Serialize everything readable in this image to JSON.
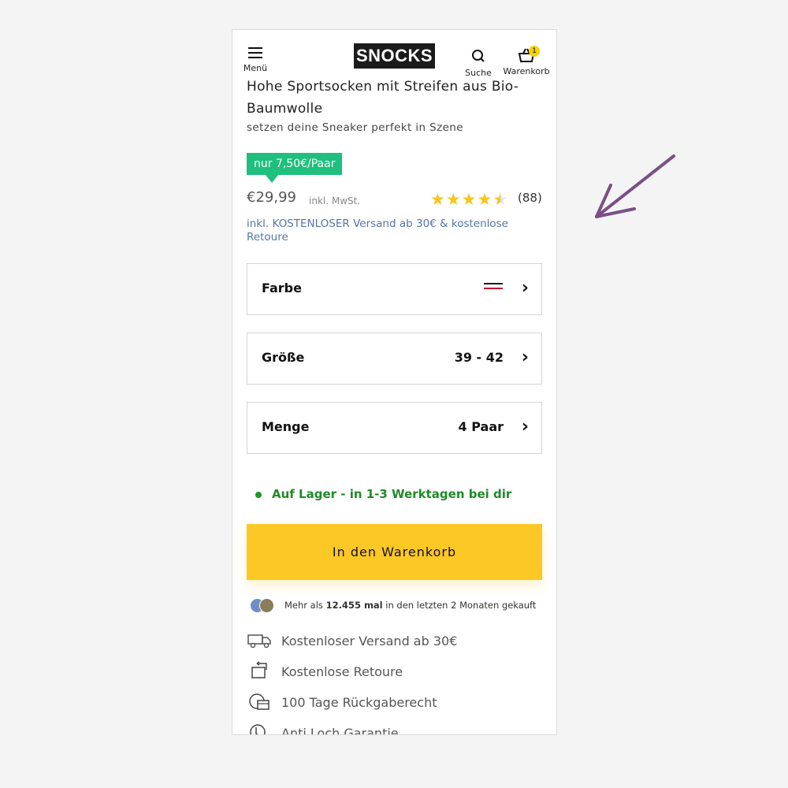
{
  "header": {
    "menu_label": "Menü",
    "logo_text": "SNOCKS",
    "search_label": "Suche",
    "cart_label": "Warenkorb",
    "cart_count": "1"
  },
  "product": {
    "title": "Hohe Sportsocken mit Streifen aus Bio-Baumwolle",
    "subtitle": "setzen deine Sneaker perfekt in Szene",
    "unit_price_badge": "nur 7,50€/Paar",
    "price": "€29,99",
    "tax_note": "inkl. MwSt.",
    "rating_stars": 4.5,
    "review_count": "(88)",
    "shipping_note": "inkl. KOSTENLOSER Versand ab 30€ & kostenlose Retoure"
  },
  "options": {
    "color": {
      "label": "Farbe",
      "swatch_colors": [
        "#1a1a1a",
        "#ffffff",
        "#c8102e"
      ]
    },
    "size": {
      "label": "Größe",
      "value": "39 - 42"
    },
    "quantity": {
      "label": "Menge",
      "value": "4 Paar"
    }
  },
  "stock": {
    "text": "Auf Lager - in 1-3 Werktagen bei dir",
    "color": "#1f8a26"
  },
  "cta": {
    "label": "In den Warenkorb",
    "color": "#fcc825"
  },
  "social_proof": {
    "prefix": "Mehr als",
    "count": "12.455 mal",
    "suffix": "in den letzten 2 Monaten gekauft"
  },
  "features": [
    {
      "icon": "truck-icon",
      "text": "Kostenloser Versand ab 30€"
    },
    {
      "icon": "return-box-icon",
      "text": "Kostenlose Retoure"
    },
    {
      "icon": "return-calendar-icon",
      "text": "100 Tage Rückgaberecht"
    },
    {
      "icon": "sock-shield-icon",
      "text": "Anti Loch Garantie"
    }
  ],
  "colors": {
    "badge": "#1fbf7d",
    "link": "#5475a6",
    "star": "#f8c51c",
    "annotation_arrow": "#7b4f86"
  }
}
